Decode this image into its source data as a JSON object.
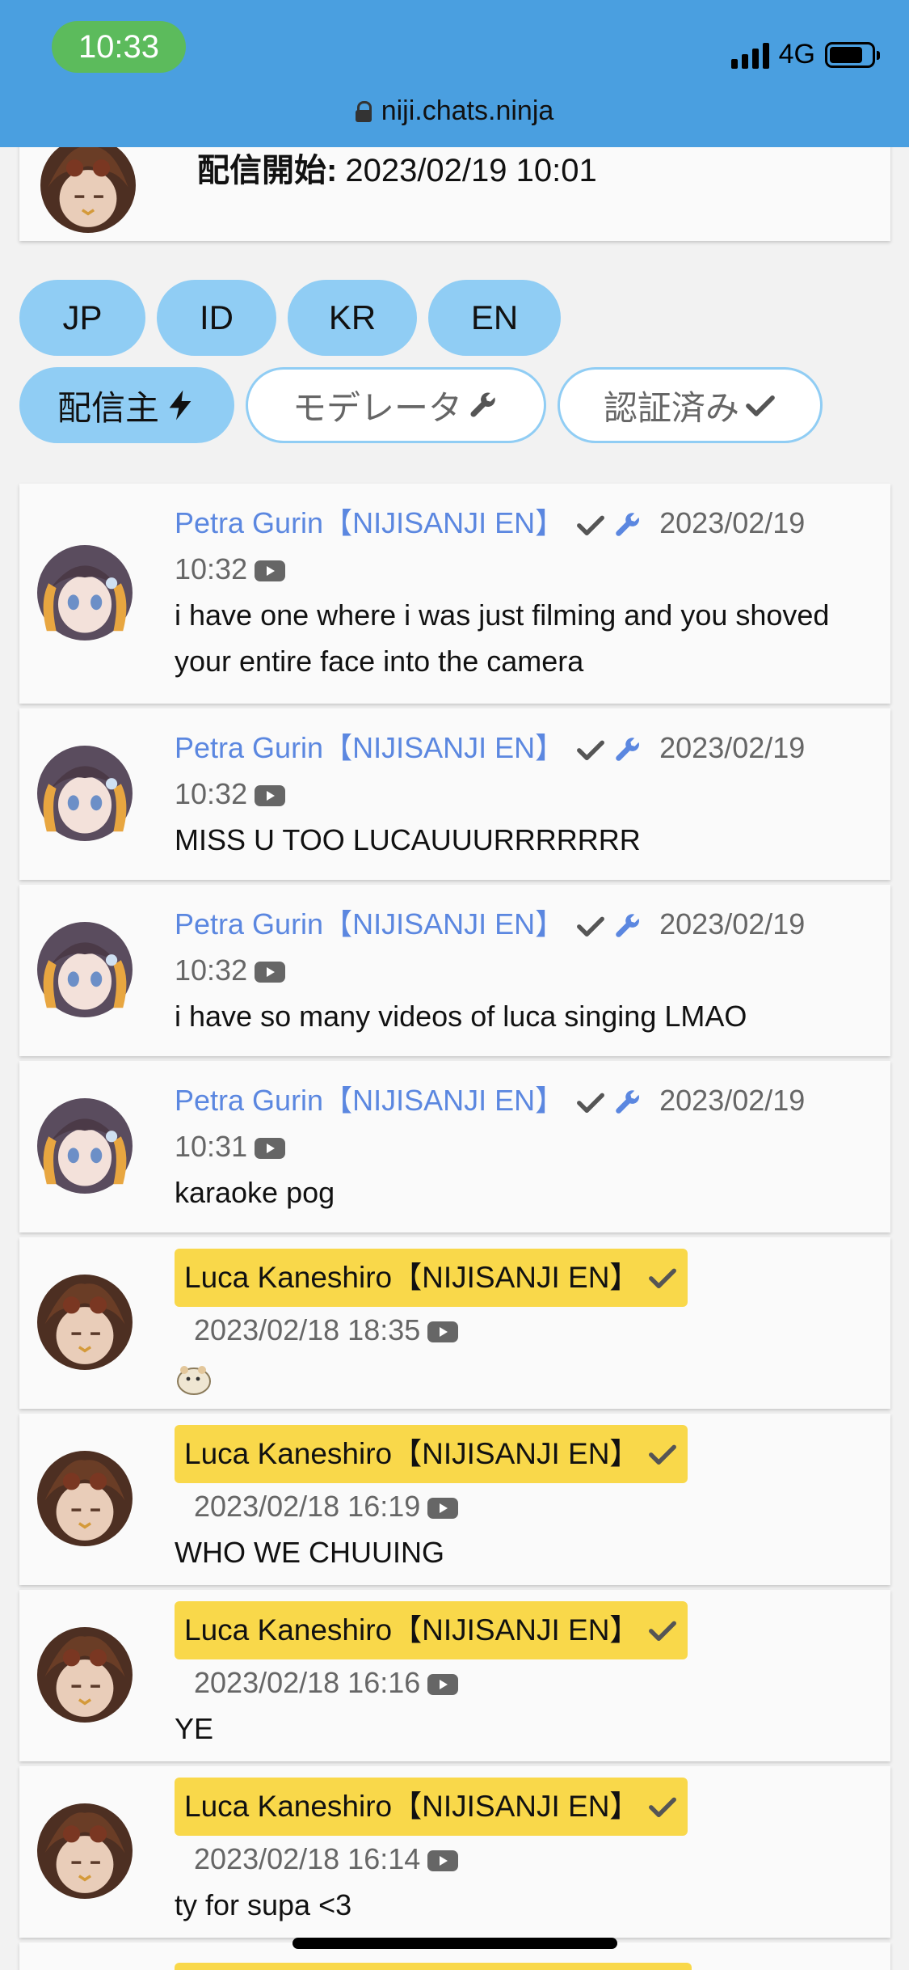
{
  "statusbar": {
    "time": "10:33",
    "network": "4G",
    "url": "niji.chats.ninja"
  },
  "stream": {
    "label": "配信開始:",
    "start_time": "2023/02/19 10:01"
  },
  "filters": {
    "languages": [
      "JP",
      "ID",
      "KR",
      "EN"
    ],
    "roles": [
      {
        "label": "配信主",
        "icon": "lightning-icon",
        "active": true
      },
      {
        "label": "モデレータ",
        "icon": "wrench-icon",
        "active": false
      },
      {
        "label": "認証済み",
        "icon": "check-icon",
        "active": false
      }
    ]
  },
  "messages": [
    {
      "author": "Petra Gurin【NIJISANJI EN】",
      "date": "2023/02/19",
      "time": "10:32",
      "text": "i have one where i was just filming and you shoved your entire face into the camera"
    },
    {
      "author": "Petra Gurin【NIJISANJI EN】",
      "date": "2023/02/19",
      "time": "10:32",
      "text": "MISS U TOO LUCAUUURRRRRRR"
    },
    {
      "author": "Petra Gurin【NIJISANJI EN】",
      "date": "2023/02/19",
      "time": "10:32",
      "text": "i have so many videos of luca singing LMAO"
    },
    {
      "author": "Petra Gurin【NIJISANJI EN】",
      "date": "2023/02/19",
      "time": "10:31",
      "text": "karaoke pog"
    },
    {
      "author": "Luca Kaneshiro【NIJISANJI EN】",
      "timestamp": "2023/02/18 18:35",
      "text": ""
    },
    {
      "author": "Luca Kaneshiro【NIJISANJI EN】",
      "timestamp": "2023/02/18 16:19",
      "text": "WHO WE CHUUING"
    },
    {
      "author": "Luca Kaneshiro【NIJISANJI EN】",
      "timestamp": "2023/02/18 16:16",
      "text": "YE"
    },
    {
      "author": "Luca Kaneshiro【NIJISANJI EN】",
      "timestamp": "2023/02/18 16:14",
      "text": "ty for supa <3"
    }
  ]
}
